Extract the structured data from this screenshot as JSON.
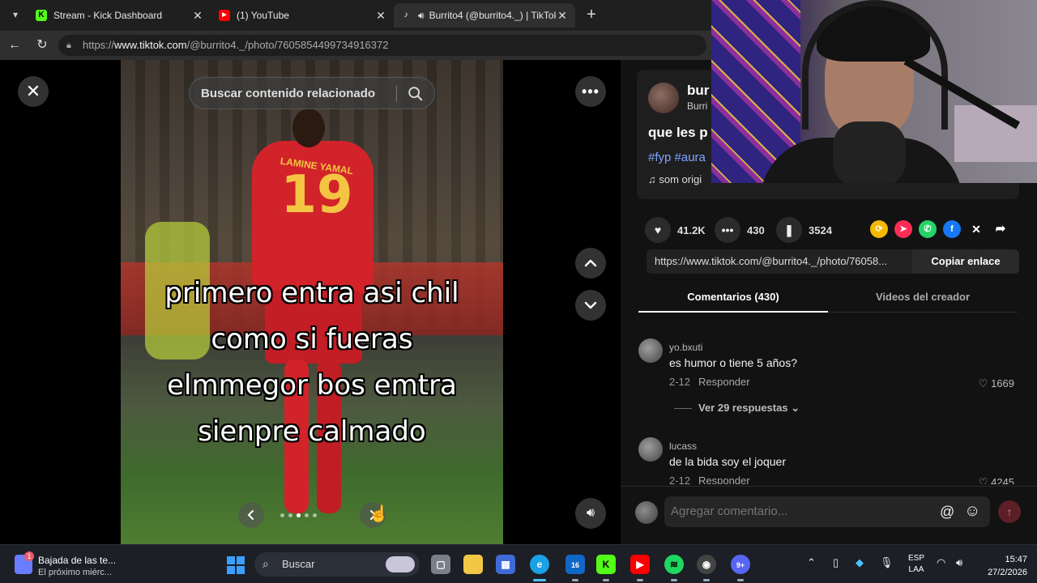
{
  "browser": {
    "tabs": [
      {
        "title": "Stream - Kick Dashboard",
        "favicon": "kick-icon",
        "color": "#53fc18"
      },
      {
        "title": "(1) YouTube",
        "favicon": "youtube-icon",
        "color": "#ff0000"
      },
      {
        "title": "Burrito4 (@burrito4._) | TikTok",
        "favicon": "tiktok-icon",
        "color": "#111111",
        "active": true
      }
    ],
    "url_prefix": "https://",
    "url_host": "www.tiktok.com",
    "url_path": "/@burrito4._/photo/7605854499734916372"
  },
  "viewer": {
    "search_placeholder": "Buscar contenido relacionado",
    "shirt_name": "LAMINE YAMAL",
    "shirt_number": "19",
    "caption_lines": [
      "primero entra asi chil",
      "como si fueras",
      "elmmegor bos emtra",
      "sienpre calmado"
    ],
    "photo_count": 5,
    "active_photo": 3
  },
  "post": {
    "author_name": "bur",
    "author_handle": "Burri",
    "description": "que les p",
    "tags": "#fyp #aura",
    "music": "som origi",
    "likes": "41.2K",
    "comments": "430",
    "saves": "3524",
    "link": "https://www.tiktok.com/@burrito4._/photo/76058...",
    "copy_label": "Copiar enlace"
  },
  "tabs": {
    "comments_label": "Comentarios (430)",
    "creator_label": "Videos del creador"
  },
  "comments": [
    {
      "user": "yo.bxuti",
      "text": "es humor o tiene 5 años?",
      "date": "2-12",
      "reply_label": "Responder",
      "likes": "1669",
      "more": "Ver 29 respuestas"
    },
    {
      "user": "lucass",
      "text": "de la bida soy el joquer",
      "date": "2-12",
      "reply_label": "Responder",
      "likes": "4245",
      "more": ""
    }
  ],
  "composer": {
    "placeholder": "Agregar comentario..."
  },
  "taskbar": {
    "notif_title": "Bajada de las te...",
    "notif_sub": "El próximo miérc...",
    "notif_badge": "1",
    "search_label": "Buscar",
    "outlook_badge": "16",
    "discord_badge": "9+",
    "lang_top": "ESP",
    "lang_bottom": "LAA",
    "time": "15:47",
    "date": "27/2/2026"
  },
  "colors": {
    "accent_red": "#fe2c55",
    "link_blue": "#7ea6ff"
  }
}
